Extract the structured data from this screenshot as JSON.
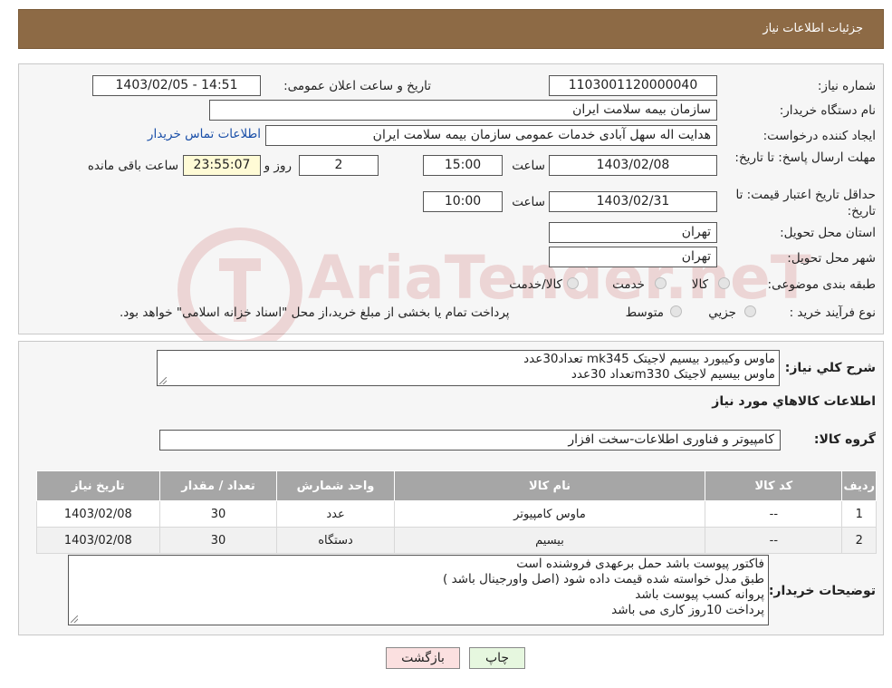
{
  "header": {
    "title": "جزئیات اطلاعات نیاز"
  },
  "info": {
    "need_number_label": "شماره نیاز:",
    "need_number": "1103001120000040",
    "announce_label": "تاریخ و ساعت اعلان عمومی:",
    "announce_value": "1403/02/05 - 14:51",
    "buyer_org_label": "نام دستگاه خریدار:",
    "buyer_org": "سازمان بیمه سلامت ایران",
    "creator_label": "ایجاد کننده درخواست:",
    "creator": "هدایت اله سهل آبادی خدمات عمومی سازمان بیمه سلامت ایران",
    "contact_link": "اطلاعات تماس خریدار",
    "deadline_label": "مهلت ارسال پاسخ: تا تاریخ:",
    "deadline_date": "1403/02/08",
    "time_label": "ساعت",
    "deadline_time": "15:00",
    "days_value": "2",
    "days_label": "روز و",
    "remaining_time": "23:55:07",
    "remaining_label": "ساعت باقی مانده",
    "validity_label": "حداقل تاریخ اعتبار قیمت: تا تاریخ:",
    "validity_date": "1403/02/31",
    "validity_time": "10:00",
    "province_label": "استان محل تحویل:",
    "province": "تهران",
    "city_label": "شهر محل تحویل:",
    "city": "تهران",
    "category_label": "طبقه بندی موضوعی:",
    "category_options": [
      "کالا",
      "خدمت",
      "کالا/خدمت"
    ],
    "process_label": "نوع فرآیند خرید :",
    "process_options": [
      "جزیي",
      "متوسط"
    ],
    "process_note": "پرداخت تمام یا بخشی از مبلغ خرید،از محل \"اسناد خزانه اسلامی\" خواهد بود."
  },
  "details": {
    "summary_label": "شرح كلي نياز:",
    "summary_lines": [
      "ماوس وکیبورد بیسیم لاجیتک mk345  تعداد30عدد",
      "ماوس بیسیم لاجیتک m330تعداد 30عدد"
    ],
    "goods_info_title": "اطلاعات كالاهاي مورد نياز",
    "goods_group_label": "گروه کالا:",
    "goods_group": "کامپیوتر و فناوری اطلاعات-سخت افزار",
    "table": {
      "headers": [
        "ردیف",
        "کد کالا",
        "نام کالا",
        "واحد شمارش",
        "تعداد / مقدار",
        "تاریخ نیاز"
      ],
      "rows": [
        [
          "1",
          "--",
          "ماوس کامپیوتر",
          "عدد",
          "30",
          "1403/02/08"
        ],
        [
          "2",
          "--",
          "بیسیم",
          "دستگاه",
          "30",
          "1403/02/08"
        ]
      ]
    },
    "buyer_notes_label": "توضیحات خریدار:",
    "buyer_notes_lines": [
      "فاکتور پیوست باشد حمل برعهدی فروشنده است",
      "طبق مدل خواسته شده قیمت داده شود (اصل واورجینال باشد )",
      "پروانه کسب پیوست باشد",
      "پرداخت 10روز کاری می باشد"
    ]
  },
  "buttons": {
    "print": "چاپ",
    "back": "بازگشت"
  },
  "watermark": {
    "text": "AriaTender.neT",
    "icon": "ariatender-logo-icon"
  },
  "colors": {
    "header_bg": "#8d6a45",
    "table_header_bg": "#a6a6a6",
    "print_bg": "#e6f7df",
    "back_bg": "#fbe0e0",
    "link": "#1a4fa8"
  }
}
